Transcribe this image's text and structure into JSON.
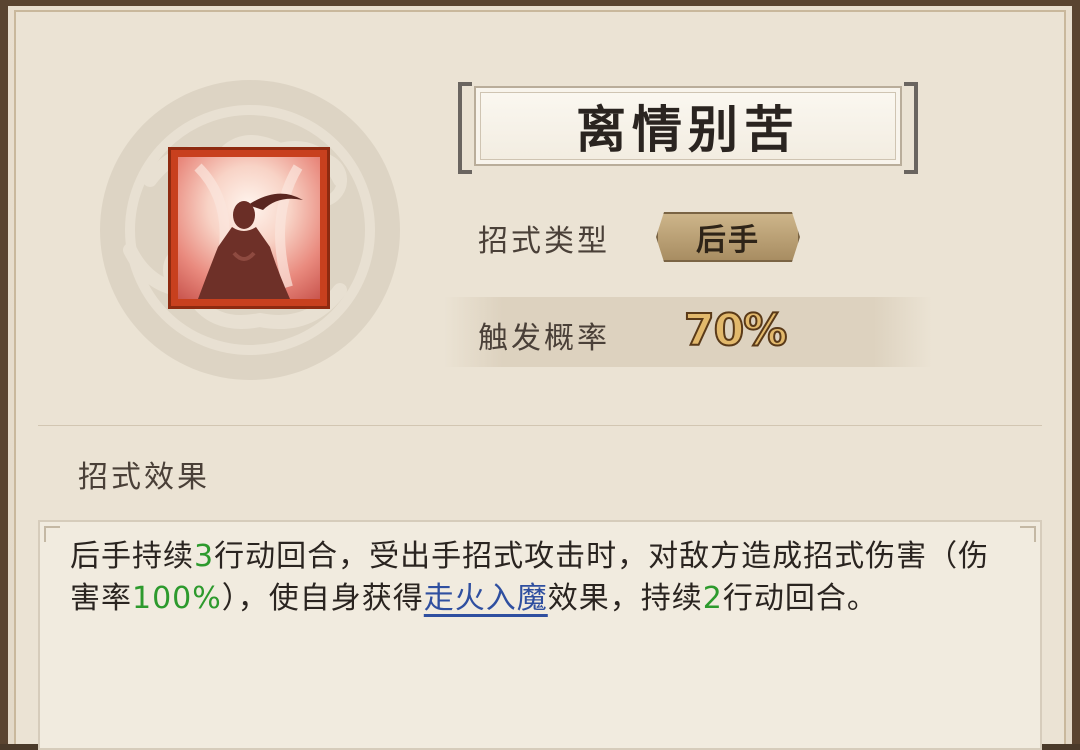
{
  "skill": {
    "name": "离情别苦",
    "icon": "meditating-swordswoman-icon",
    "type_label": "招式类型",
    "type_value": "后手",
    "rate_label": "触发概率",
    "rate_value": "70%"
  },
  "effect": {
    "section_label": "招式效果",
    "segments": [
      {
        "text": "后手持续",
        "style": "normal"
      },
      {
        "text": "3",
        "style": "green"
      },
      {
        "text": "行动回合，受出手招式攻击时，对敌方造成招式伤害（伤害率",
        "style": "normal"
      },
      {
        "text": "100%",
        "style": "green"
      },
      {
        "text": "），使自身获得",
        "style": "normal"
      },
      {
        "text": "走火入魔",
        "style": "link"
      },
      {
        "text": "效果，持续",
        "style": "normal"
      },
      {
        "text": "2",
        "style": "green"
      },
      {
        "text": "行动回合。",
        "style": "normal"
      }
    ]
  },
  "colors": {
    "green": "#2d9a2d",
    "link": "#2f4fa0",
    "frame": "#5a4430",
    "icon_border": "#c8401e"
  }
}
